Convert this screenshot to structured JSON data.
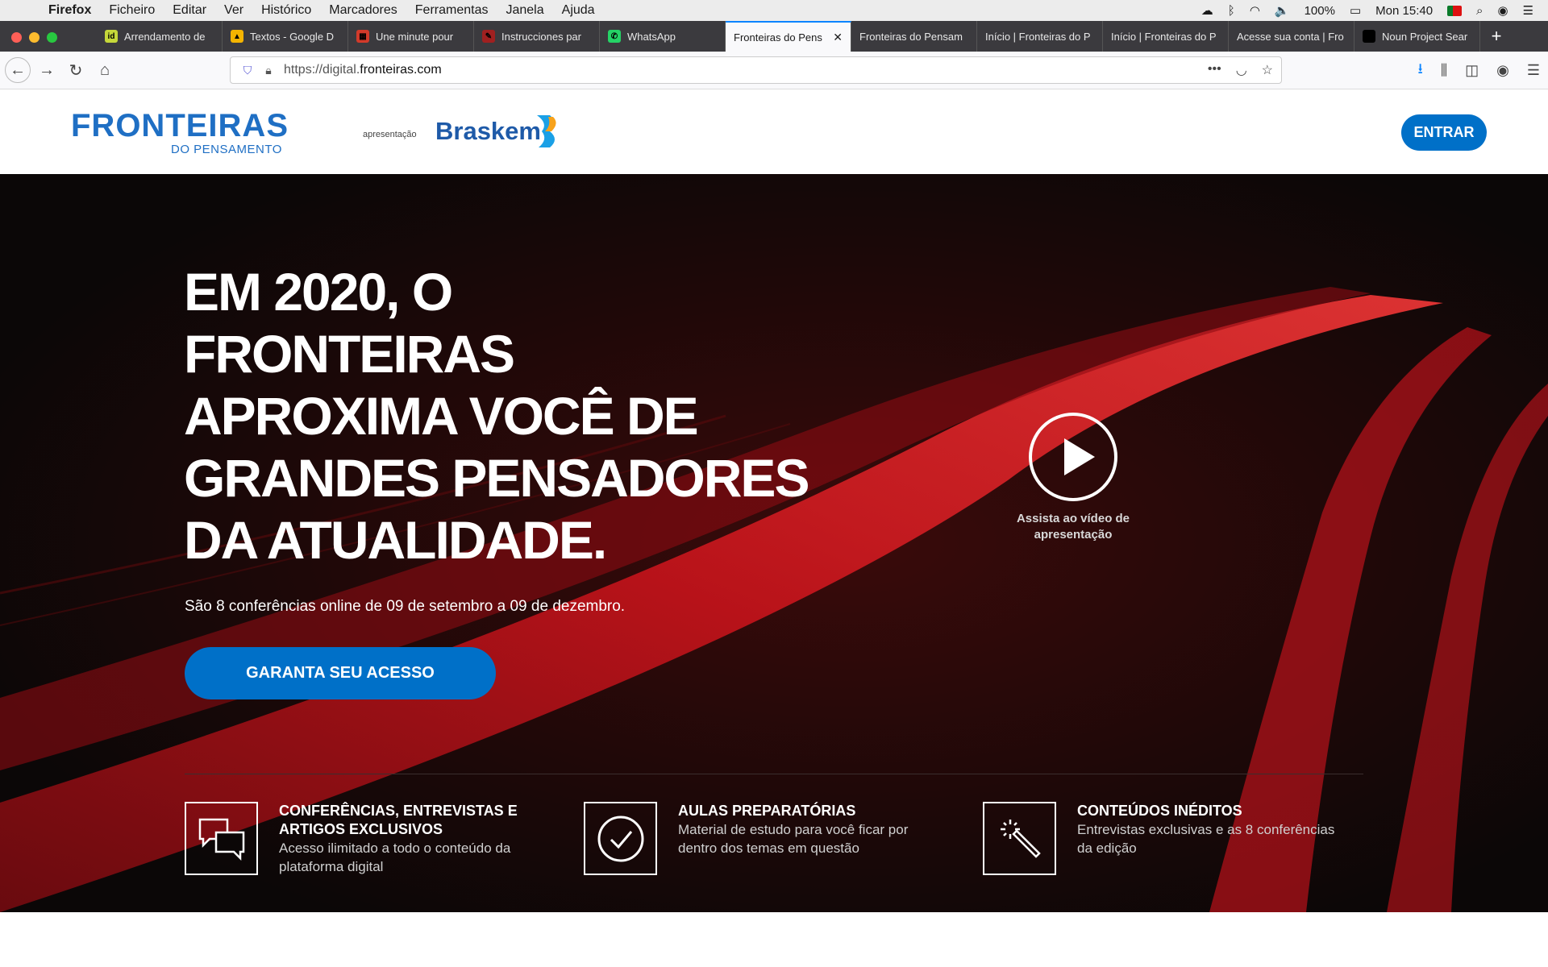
{
  "os_menubar": {
    "app": "Firefox",
    "items": [
      "Ficheiro",
      "Editar",
      "Ver",
      "Histórico",
      "Marcadores",
      "Ferramentas",
      "Janela",
      "Ajuda"
    ],
    "battery": "100%",
    "clock": "Mon 15:40"
  },
  "browser": {
    "tabs": [
      {
        "label": "Arrendamento de",
        "favicon_color": "#c6d83a",
        "icon": "id"
      },
      {
        "label": "Textos - Google D",
        "favicon_color": "#f4b400",
        "icon": "▲"
      },
      {
        "label": "Une minute pour",
        "favicon_color": "#d23a2a",
        "icon": "▦"
      },
      {
        "label": "Instrucciones par",
        "favicon_color": "#a02020",
        "icon": "✎"
      },
      {
        "label": "WhatsApp",
        "favicon_color": "#25d366",
        "icon": "✆"
      },
      {
        "label": "Fronteiras do Pens",
        "favicon_color": "",
        "icon": ""
      },
      {
        "label": "Fronteiras do Pensam",
        "favicon_color": "",
        "icon": ""
      },
      {
        "label": "Início | Fronteiras do P",
        "favicon_color": "",
        "icon": ""
      },
      {
        "label": "Início | Fronteiras do P",
        "favicon_color": "",
        "icon": ""
      },
      {
        "label": "Acesse sua conta | Fro",
        "favicon_color": "",
        "icon": ""
      },
      {
        "label": "Noun Project Sear",
        "favicon_color": "#000000",
        "icon": "•••"
      }
    ],
    "url_prefix": "https://digital.",
    "url_domain": "fronteiras.com"
  },
  "site": {
    "logo_text": "FRONTEIRAS",
    "logo_sub": "DO PENSAMENTO",
    "presentation_label": "apresentação",
    "sponsor": "Braskem",
    "login_label": "ENTRAR"
  },
  "hero": {
    "headline_lines": [
      "EM 2020, O",
      "FRONTEIRAS",
      "APROXIMA VOCÊ DE",
      "GRANDES PENSADORES",
      "DA ATUALIDADE."
    ],
    "subtitle": "São 8 conferências online de 09 de setembro a 09 de dezembro.",
    "cta_label": "GARANTA SEU ACESSO",
    "video_caption": "Assista ao vídeo de apresentação"
  },
  "features": [
    {
      "icon": "chat-bubbles-icon",
      "title": "CONFERÊNCIAS, ENTREVISTAS E ARTIGOS EXCLUSIVOS",
      "desc": "Acesso ilimitado a todo o conteúdo da plataforma digital"
    },
    {
      "icon": "checkmark-circle-icon",
      "title": "AULAS PREPARATÓRIAS",
      "desc": "Material de estudo para você ficar por dentro dos temas em questão"
    },
    {
      "icon": "magic-wand-icon",
      "title": "CONTEÚDOS INÉDITOS",
      "desc": "Entrevistas exclusivas e as 8 conferências da edição"
    }
  ],
  "colors": {
    "brand_blue": "#0070c8",
    "logo_blue": "#1f6fc4",
    "hero_bg": "#0b0707",
    "light_trails": "#c4121a"
  }
}
